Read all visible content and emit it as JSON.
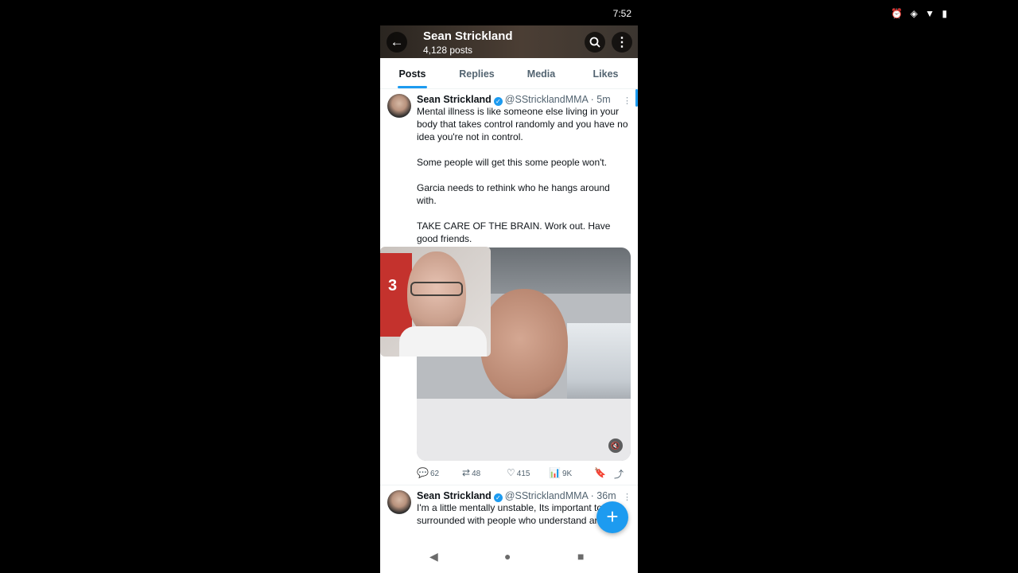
{
  "status_bar": {
    "icons": "⏰ ◈ ▼ ▮",
    "time": "7:52"
  },
  "header": {
    "title": "Sean Strickland",
    "subtitle": "4,128 posts"
  },
  "tabs": [
    {
      "label": "Posts",
      "active": true
    },
    {
      "label": "Replies"
    },
    {
      "label": "Media"
    },
    {
      "label": "Likes"
    }
  ],
  "posts": [
    {
      "name": "Sean Strickland",
      "handle": "@SStricklandMMA",
      "time": "· 5m",
      "paragraphs": [
        "Mental illness is like someone else living in your body that takes control randomly and you have no idea you're not in control.",
        "Some people will get this some people won't.",
        "Garcia needs to rethink who he hangs around with.",
        "TAKE CARE OF THE BRAIN. Work out. Have good friends."
      ],
      "replies": "62",
      "reposts": "48",
      "likes": "415",
      "views": "9K"
    },
    {
      "name": "Sean Strickland",
      "handle": "@SStricklandMMA",
      "time": "· 36m",
      "text": "I'm a little mentally unstable, Its important to be surrounded with people who understand and help"
    }
  ],
  "overlay": {
    "jersey_text": "3"
  },
  "colors": {
    "accent": "#1d9bf0",
    "text": "#0f1419",
    "muted": "#536471"
  },
  "icons": {
    "back": "←",
    "search": "⚲",
    "more": "⋮",
    "verified": "✓",
    "mute": "🔇",
    "reply": "💬",
    "repost": "⇄",
    "like": "♡",
    "views": "📊",
    "bookmark": "🔖",
    "share": "⤴",
    "compose": "+",
    "nav_back": "◀",
    "nav_home": "●",
    "nav_recents": "■"
  }
}
